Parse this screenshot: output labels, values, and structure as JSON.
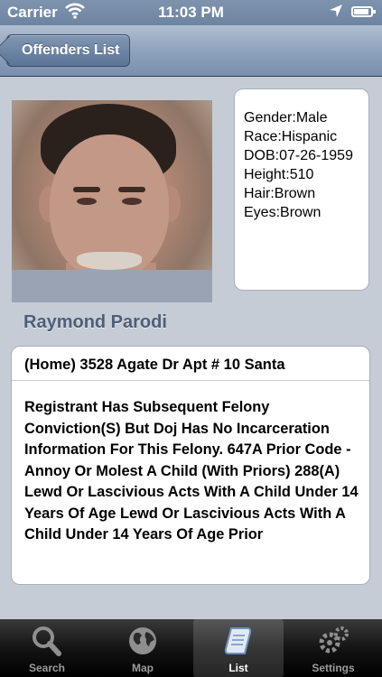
{
  "status_bar": {
    "carrier": "Carrier",
    "time": "11:03 PM"
  },
  "nav": {
    "back_label": "Offenders List"
  },
  "offender": {
    "name": "Raymond Parodi",
    "details": [
      "Gender:Male",
      "Race:Hispanic",
      "DOB:07-26-1959",
      "Height:510",
      "Hair:Brown",
      "Eyes:Brown"
    ],
    "address": "(Home) 3528 Agate Dr Apt # 10 Santa",
    "description": "Registrant Has Subsequent Felony Conviction(S) But Doj Has No Incarceration Information For This Felony. 647A Prior Code - Annoy Or Molest A Child (With Priors) 288(A) Lewd Or Lascivious Acts With A Child Under 14 Years Of Age Lewd Or Lascivious Acts With A Child Under 14 Years Of Age Prior"
  },
  "tabs": [
    {
      "label": "Search",
      "icon": "magnifier-icon"
    },
    {
      "label": "Map",
      "icon": "globe-icon"
    },
    {
      "label": "List",
      "icon": "scroll-icon",
      "active": true
    },
    {
      "label": "Settings",
      "icon": "gears-icon"
    }
  ],
  "colors": {
    "nav_bar": "#8ea3bc",
    "background": "#c5ccd6",
    "name_text": "#4f5e77",
    "tab_bar": "#141414"
  }
}
